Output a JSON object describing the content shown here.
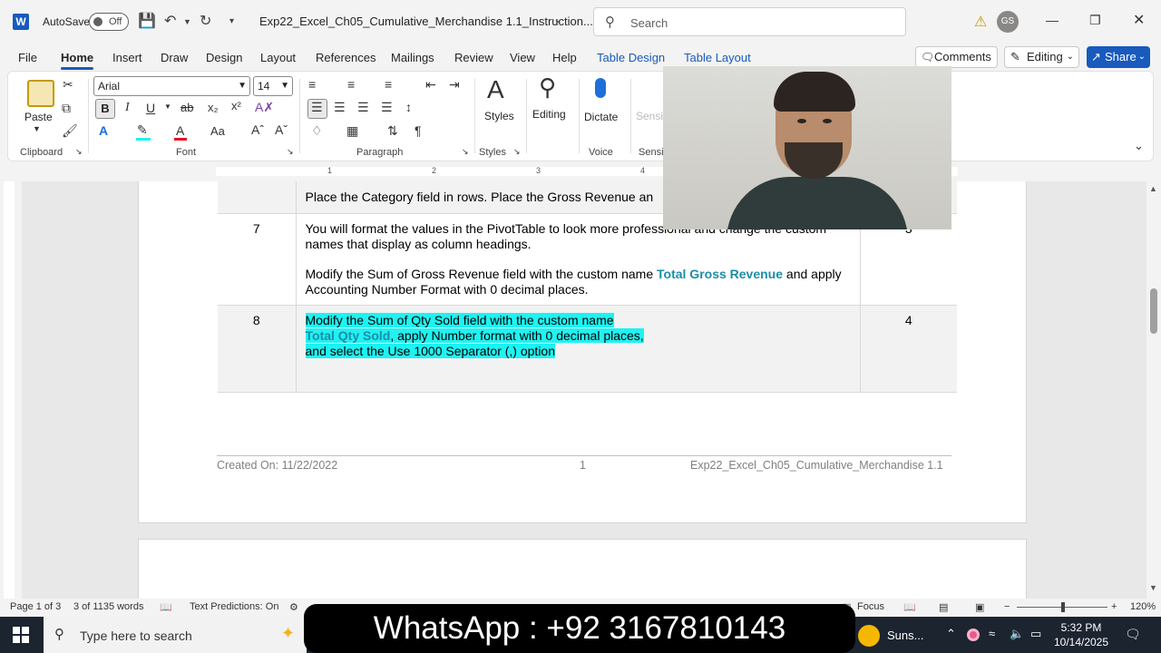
{
  "titlebar": {
    "autosave_label": "AutoSave",
    "autosave_state": "Off",
    "doc_title": "Exp22_Excel_Ch05_Cumulative_Merchandise 1.1_Instruction...",
    "search_placeholder": "Search",
    "avatar_initials": "GS"
  },
  "menu": {
    "tabs": [
      "File",
      "Home",
      "Insert",
      "Draw",
      "Design",
      "Layout",
      "References",
      "Mailings",
      "Review",
      "View",
      "Help",
      "Table Design",
      "Table Layout"
    ],
    "active_tab": "Home",
    "comments_label": "Comments",
    "editing_label": "Editing",
    "share_label": "Share"
  },
  "ribbon": {
    "paste_label": "Paste",
    "font_name": "Arial",
    "font_size": "14",
    "bold_label": "B",
    "italic_label": "I",
    "underline_label": "U",
    "strike_label": "ab",
    "styles_label": "Styles",
    "editing_label": "Editing",
    "dictate_label": "Dictate",
    "sensitivity_label": "Sensi",
    "groups": {
      "clipboard": "Clipboard",
      "font": "Font",
      "paragraph": "Paragraph",
      "styles": "Styles",
      "voice": "Voice",
      "sensitivity": "Sensit"
    }
  },
  "ruler": {
    "numbers": [
      "1",
      "2",
      "3",
      "4"
    ]
  },
  "document": {
    "rows": [
      {
        "num": "",
        "text": "Place the Category field in rows. Place the Gross Revenue an",
        "points": ""
      },
      {
        "num": "7",
        "para1": "You will format the values in the PivotTable to look more professional and change the custom names that display as column headings.",
        "para2_before": "Modify the Sum of Gross Revenue field with the custom name ",
        "para2_kw": "Total Gross Revenue",
        "para2_after": " and apply Accounting Number Format with 0 decimal places.",
        "points": "3"
      },
      {
        "num": "8",
        "line1": "Modify the Sum of Qty Sold field with the custom name",
        "kw": "Total Qty Sold",
        "line2_after": ", apply Number format with 0 decimal places,",
        "line3": "and select the Use 1000 Separator (,) option",
        "points": "4"
      }
    ],
    "footer": {
      "created": "Created On: 11/22/2022",
      "page": "1",
      "filename": "Exp22_Excel_Ch05_Cumulative_Merchandise 1.1"
    }
  },
  "statusbar": {
    "page": "Page 1 of 3",
    "words": "3 of 1135 words",
    "predictions": "Text Predictions: On",
    "focus": "Focus",
    "zoom": "120%"
  },
  "taskbar": {
    "search_placeholder": "Type here to search",
    "banner": "WhatsApp : +92 3167810143",
    "weather": "Suns...",
    "time": "5:32 PM",
    "date": "10/14/2025"
  },
  "colors": {
    "accent": "#185abd",
    "highlight": "#1ff2f2",
    "keyword": "#1a8fa8"
  }
}
